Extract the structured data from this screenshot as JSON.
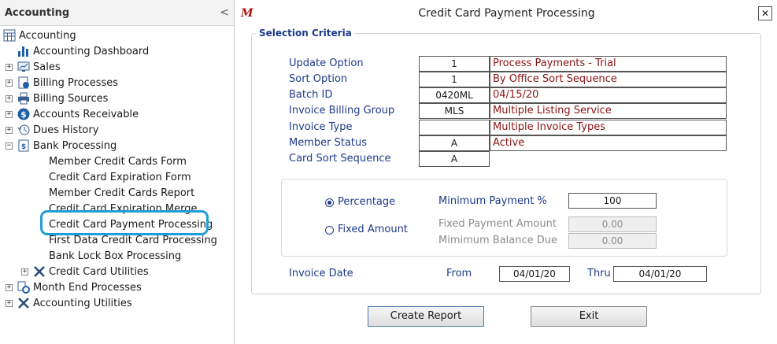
{
  "sidebar": {
    "title": "Accounting",
    "collapse_glyph": "<",
    "root": {
      "label": "Accounting",
      "icon": "calculator-icon"
    },
    "items": [
      {
        "label": "Accounting Dashboard",
        "icon": "bar-chart-icon",
        "expander": ""
      },
      {
        "label": "Sales",
        "icon": "monitor-chart-icon",
        "expander": "+"
      },
      {
        "label": "Billing Processes",
        "icon": "billing-doc-icon",
        "expander": "+"
      },
      {
        "label": "Billing Sources",
        "icon": "printer-icon",
        "expander": "+"
      },
      {
        "label": "Accounts Receivable",
        "icon": "dollar-icon",
        "expander": "+"
      },
      {
        "label": "Dues History",
        "icon": "history-icon",
        "expander": "+"
      },
      {
        "label": "Bank Processing",
        "icon": "bank-doc-icon",
        "expander": "−"
      }
    ],
    "bank_children": [
      "Member Credit Cards Form",
      "Credit Card Expiration Form",
      "Member Credit Cards Report",
      "Credit Card Expiration Merge",
      "Credit Card Payment Processing",
      "First Data Credit Card Processing",
      "Bank Lock Box Processing"
    ],
    "tail_items": [
      {
        "label": "Credit Card Utilities",
        "icon": "tools-icon",
        "expander": "+"
      },
      {
        "label": "Month End Processes",
        "icon": "gears-icon",
        "expander": "+"
      },
      {
        "label": "Accounting Utilities",
        "icon": "tools-icon",
        "expander": "+"
      }
    ]
  },
  "dialog": {
    "logo": "M",
    "title": "Credit Card Payment Processing",
    "close_glyph": "✕",
    "criteria_legend": "Selection Criteria",
    "fields": [
      {
        "label": "Update Option",
        "code": "1",
        "desc": "Process Payments - Trial"
      },
      {
        "label": "Sort Option",
        "code": "1",
        "desc": "By Office Sort Sequence"
      },
      {
        "label": "Batch ID",
        "code": "0420ML",
        "desc": "04/15/20"
      },
      {
        "label": "Invoice Billing Group",
        "code": "MLS",
        "desc": "Multiple Listing Service"
      },
      {
        "label": "Invoice Type",
        "code": "",
        "desc": "Multiple Invoice Types"
      },
      {
        "label": "Member Status",
        "code": "A",
        "desc": "Active"
      },
      {
        "label": "Card Sort Sequence",
        "code": "A",
        "desc": null
      }
    ],
    "payment": {
      "percentage_label": "Percentage",
      "percentage_selected": true,
      "fixed_label": "Fixed Amount",
      "fixed_selected": false,
      "min_payment_label": "Minimum Payment %",
      "min_payment_value": "100",
      "fixed_amount_label": "Fixed Payment Amount",
      "fixed_amount_value": "0.00",
      "min_balance_label": "Mimimum Balance Due",
      "min_balance_value": "0.00"
    },
    "invoice_date": {
      "label": "Invoice Date",
      "from_label": "From",
      "from_value": "04/01/20",
      "thru_label": "Thru",
      "thru_value": "04/01/20"
    },
    "buttons": {
      "create": "Create Report",
      "exit": "Exit"
    }
  },
  "colors": {
    "label_blue": "#1f3a8a",
    "desc_red": "#8a1212",
    "highlight_ring": "#1e9ed8",
    "logo_red": "#b01010"
  }
}
